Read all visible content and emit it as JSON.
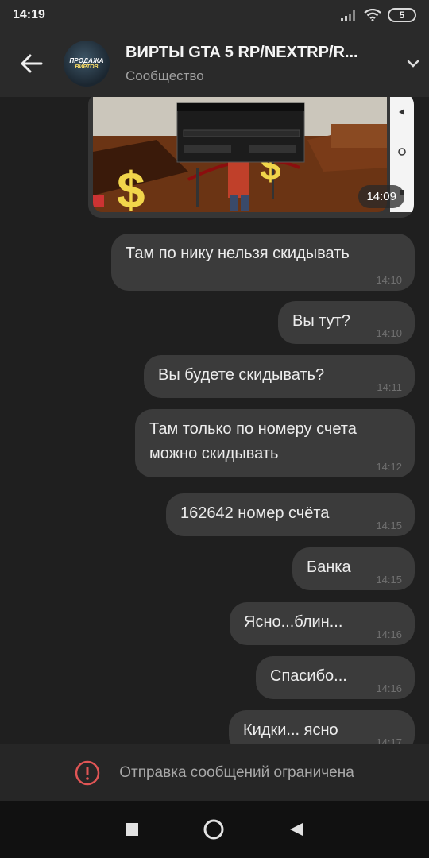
{
  "status": {
    "time": "14:19",
    "battery": "5"
  },
  "header": {
    "title": "ВИРТЫ GTA 5 RP/NEXTRP/R...",
    "subtitle": "Сообщество",
    "avatar_line1": "ПРОДАЖА",
    "avatar_line2": "ВИРТОВ"
  },
  "image_message": {
    "time": "14:09"
  },
  "messages": [
    {
      "text": "Там по нику нельзя скидывать",
      "time": "14:10"
    },
    {
      "text": "Вы тут?",
      "time": "14:10"
    },
    {
      "text": "Вы будете скидывать?",
      "time": "14:11"
    },
    {
      "text": "Там только по номеру счета",
      "text2": "можно скидывать",
      "time": "14:12"
    },
    {
      "text": "162642 номер счёта",
      "time": "14:15"
    },
    {
      "text": "Банка",
      "time": "14:15"
    },
    {
      "text": "Ясно...блин...",
      "time": "14:16"
    },
    {
      "text": "Спасибо...",
      "time": "14:16"
    },
    {
      "text": "Кидки... ясно",
      "time": "14:17"
    }
  ],
  "footer": {
    "restricted_text": "Отправка сообщений ограничена"
  },
  "colors": {
    "background": "#1f1f1f",
    "bubble": "#3b3b3b",
    "warning": "#e05555"
  },
  "icons": [
    "back-arrow-icon",
    "chevron-down-icon",
    "signal-icon",
    "wifi-icon",
    "battery-icon",
    "warning-icon",
    "nav-square-icon",
    "nav-circle-icon",
    "nav-triangle-icon"
  ]
}
